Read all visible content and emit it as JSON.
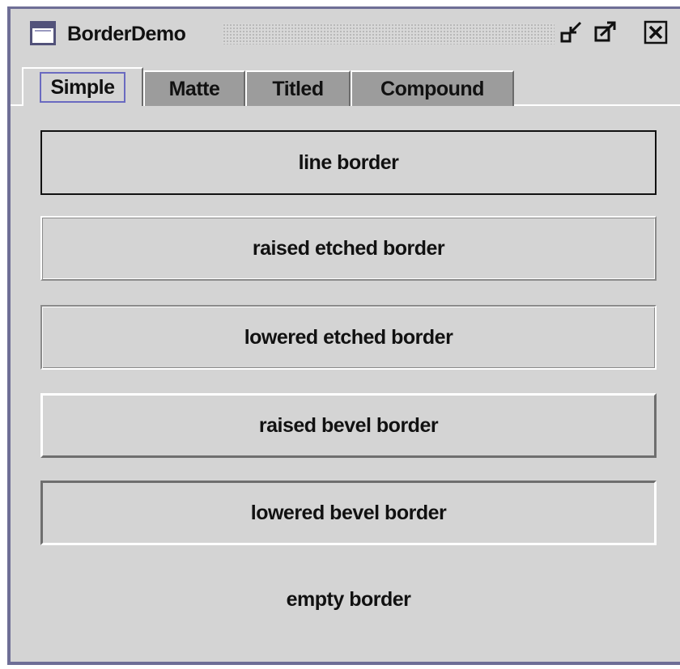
{
  "window": {
    "title": "BorderDemo",
    "icons": [
      "app-window-icon",
      "minimize-icon",
      "maximize-icon",
      "close-icon"
    ]
  },
  "tabs": [
    {
      "label": "Simple",
      "active": true
    },
    {
      "label": "Matte",
      "active": false
    },
    {
      "label": "Titled",
      "active": false
    },
    {
      "label": "Compound",
      "active": false
    }
  ],
  "panel": {
    "line": "line border",
    "raised_etched": "raised etched border",
    "lowered_etched": "lowered etched border",
    "raised_bevel": "raised bevel border",
    "lowered_bevel": "lowered bevel border",
    "empty": "empty border"
  },
  "colors": {
    "frame": "#6e6e96",
    "background": "#d4d4d4",
    "inactive_tab": "#9c9c9c",
    "focus": "#6a6ac0"
  }
}
